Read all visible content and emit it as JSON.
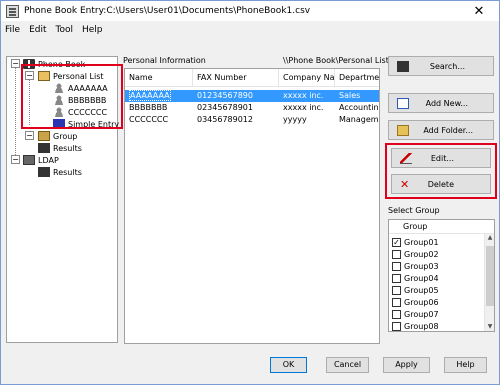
{
  "window": {
    "title": "Phone Book Entry:C:\\Users\\User01\\Documents\\PhoneBook1.csv",
    "close": "✕"
  },
  "menu": [
    {
      "label": "File",
      "key": "F"
    },
    {
      "label": "Edit",
      "key": "E"
    },
    {
      "label": "Tool",
      "key": "T"
    },
    {
      "label": "Help",
      "key": "H"
    }
  ],
  "tree": {
    "phone_book": "Phone Book",
    "personal_list": "Personal List",
    "entries": [
      "AAAAAAA",
      "BBBBBBB",
      "CCCCCCC"
    ],
    "simple_entry": "Simple Entry",
    "group": "Group",
    "group_results": "Results",
    "ldap": "LDAP",
    "ldap_results": "Results",
    "expand_minus": "−",
    "expand_plus": "+"
  },
  "list": {
    "label": "Personal Information",
    "path": "\\\\Phone Book\\Personal List",
    "columns": [
      "Name",
      "FAX Number",
      "Company Name",
      "Department"
    ],
    "rows": [
      [
        "AAAAAAA",
        "01234567890",
        "xxxxx inc.",
        "Sales"
      ],
      [
        "BBBBBBB",
        "02345678901",
        "xxxxx inc.",
        "Accounting"
      ],
      [
        "CCCCCCC",
        "03456789012",
        "yyyyy",
        "Management"
      ]
    ]
  },
  "buttons": {
    "search": "Search...",
    "add_new": "Add New...",
    "add_folder": "Add Folder...",
    "edit": "Edit...",
    "delete": "Delete"
  },
  "select_group": {
    "label": "Select Group",
    "header": "Group",
    "items": [
      {
        "name": "Group01",
        "checked": true
      },
      {
        "name": "Group02",
        "checked": false
      },
      {
        "name": "Group03",
        "checked": false
      },
      {
        "name": "Group04",
        "checked": false
      },
      {
        "name": "Group05",
        "checked": false
      },
      {
        "name": "Group06",
        "checked": false
      },
      {
        "name": "Group07",
        "checked": false
      },
      {
        "name": "Group08",
        "checked": false
      }
    ],
    "check_mark": "✓"
  },
  "footer": {
    "ok": "OK",
    "cancel": "Cancel",
    "apply": "Apply",
    "help": "Help"
  },
  "colors": {
    "highlight": "#e0001b",
    "selection": "#3399ff"
  }
}
